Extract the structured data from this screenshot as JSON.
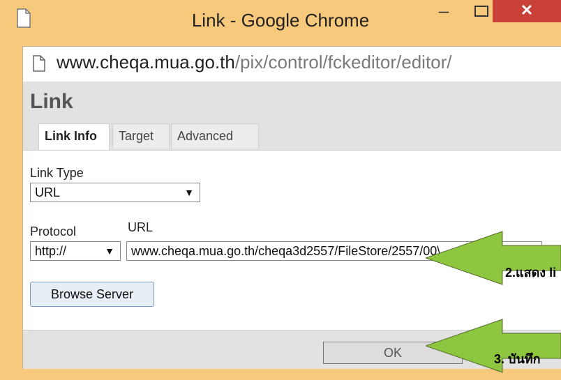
{
  "window": {
    "title": "Link - Google Chrome",
    "minimize": "–",
    "close": "✕",
    "frame_color": "#f6c97d",
    "close_color": "#c9403a"
  },
  "address_bar": {
    "host": "www.cheqa.mua.go.th",
    "path": "/pix/control/fckeditor/editor/"
  },
  "dialog": {
    "title": "Link",
    "tabs": [
      {
        "label": "Link Info",
        "active": true
      },
      {
        "label": "Target",
        "active": false
      },
      {
        "label": "Advanced",
        "active": false
      }
    ],
    "link_type": {
      "label": "Link Type",
      "value": "URL"
    },
    "protocol": {
      "label": "Protocol",
      "value": "http://"
    },
    "url": {
      "label": "URL",
      "value": "www.cheqa.mua.go.th/cheqa3d2557/FileStore/2557/00\\"
    },
    "browse_button": "Browse Server",
    "ok_button": "OK"
  },
  "annotations": {
    "callout_2": "2.แสดง li",
    "callout_3": "3. บันทึก",
    "arrow_color": "#8fc63f"
  }
}
